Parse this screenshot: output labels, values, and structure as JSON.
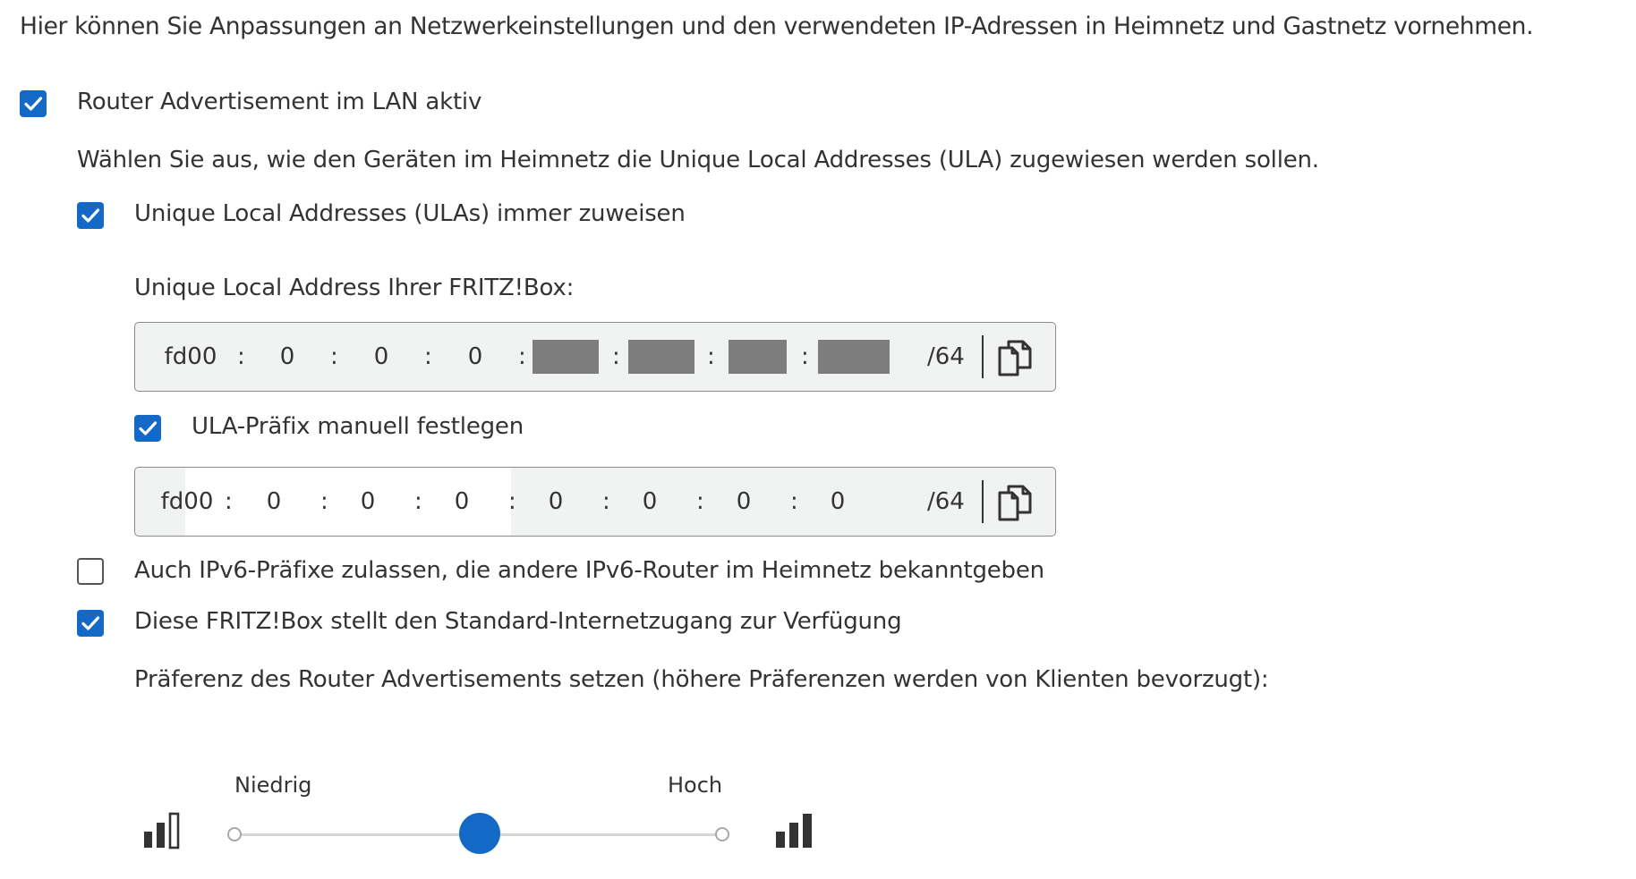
{
  "intro_text": "Hier können Sie Anpassungen an Netzwerkeinstellungen und den verwendeten IP-Adressen in Heimnetz und Gastnetz vornehmen.",
  "router_adv": {
    "label": "Router Advertisement im LAN aktiv",
    "checked": true
  },
  "ula_hint": "Wählen Sie aus, wie den Geräten im Heimnetz die Unique Local Addresses (ULA) zugewiesen werden sollen.",
  "ula_always": {
    "label": "Unique Local Addresses (ULAs) immer zuweisen",
    "checked": true
  },
  "ula_address": {
    "title": "Unique Local Address Ihrer FRITZ!Box:",
    "segments": [
      "fd00",
      "0",
      "0",
      "0"
    ],
    "prefix": "/64"
  },
  "ula_manual": {
    "label": "ULA-Präfix manuell festlegen",
    "checked": true
  },
  "ula_prefix_input": {
    "segments": [
      "fd00",
      "0",
      "0",
      "0",
      "0",
      "0",
      "0",
      "0"
    ],
    "prefix": "/64"
  },
  "ipv6_other": {
    "label": "Auch IPv6-Präfixe zulassen, die andere IPv6-Router im Heimnetz bekanntgeben",
    "checked": false
  },
  "default_access": {
    "label": "Diese FRITZ!Box stellt den Standard-Internetzugang zur Verfügung",
    "checked": true
  },
  "preference": {
    "text": "Präferenz des Router Advertisements setzen (höhere Präferenzen werden von Klienten bevorzugt):",
    "low_label": "Niedrig",
    "high_label": "Hoch",
    "value_fraction": 0.5
  },
  "colors": {
    "accent": "#1469c6",
    "mask": "#7d7d7d"
  },
  "icons": {
    "copy": "copy-icon",
    "signal_low": "signal-low-icon",
    "signal_high": "signal-high-icon",
    "check": "checkmark-icon"
  }
}
